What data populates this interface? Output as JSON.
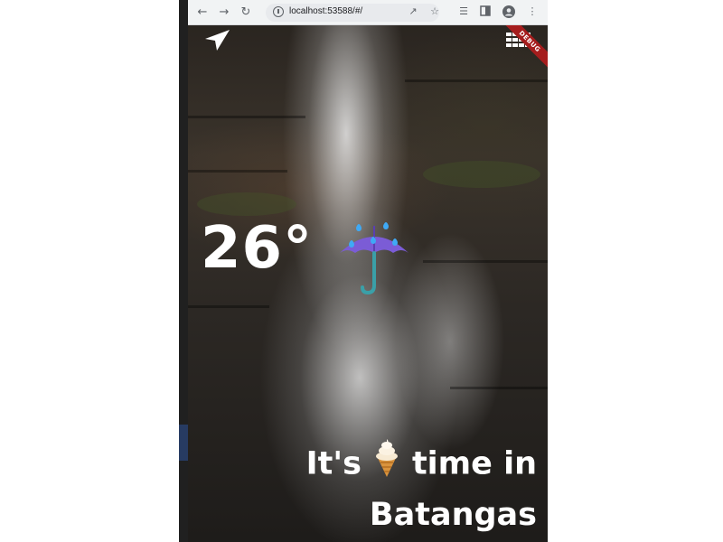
{
  "browser": {
    "url": "localhost:53588/#/",
    "icons": [
      "back-icon",
      "forward-icon",
      "reload-icon",
      "site-info-icon",
      "share-icon",
      "bookmark-star-icon",
      "media-icon",
      "side-panel-icon",
      "profile-icon",
      "menu-icon"
    ]
  },
  "app": {
    "debug_badge": "DEBUG",
    "temperature": "26°",
    "condition_icon": "umbrella-with-rain-icon",
    "message": {
      "prefix": "It's",
      "icon": "soft-ice-cream-icon",
      "suffix": "time in",
      "location": "Batangas"
    }
  },
  "colors": {
    "text": "#ffffff",
    "debug_ribbon": "#a51d1d",
    "umbrella": "#7b5cd6",
    "raindrop": "#3fa9f5"
  }
}
